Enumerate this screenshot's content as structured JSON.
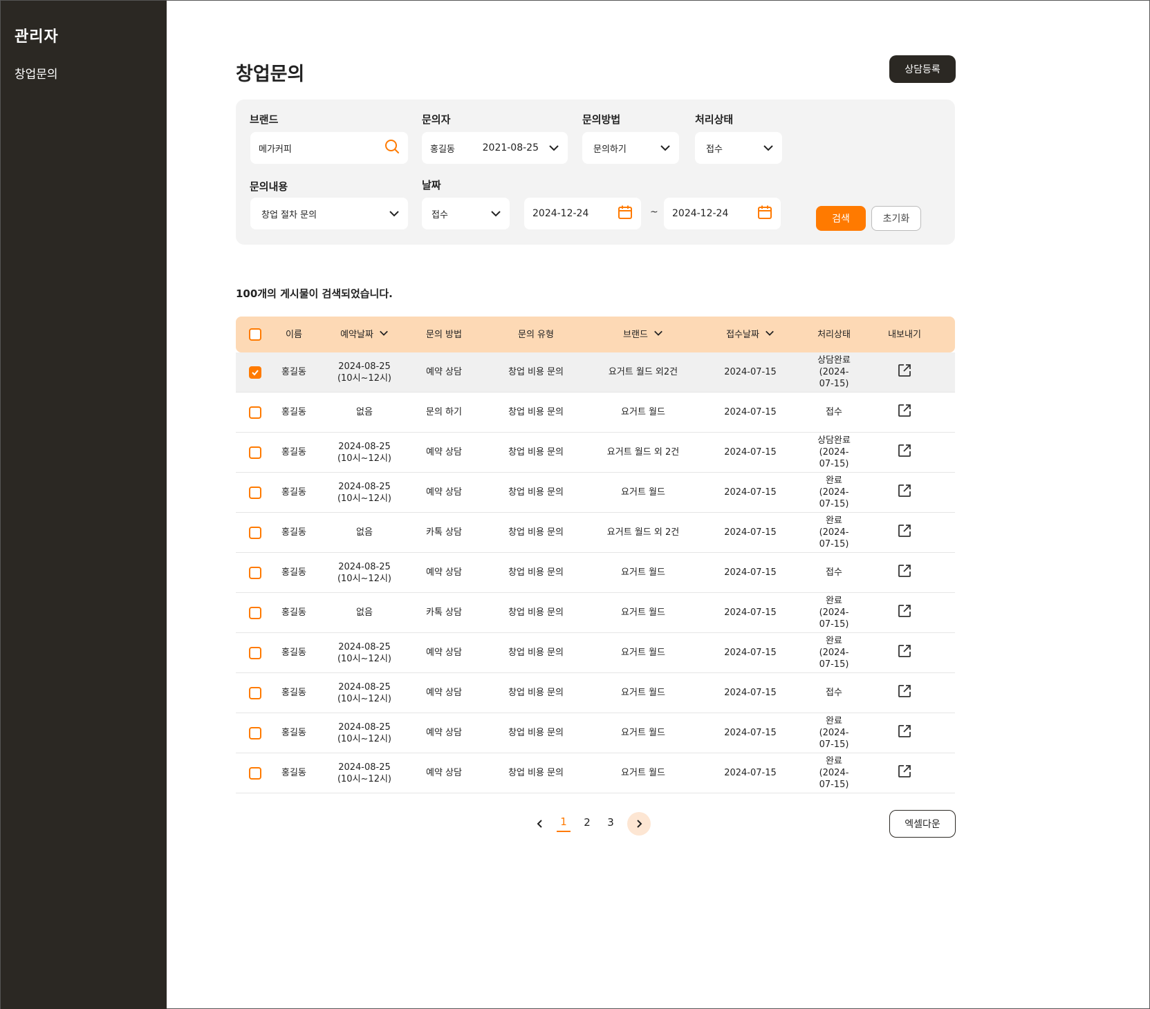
{
  "sidebar": {
    "title": "관리자",
    "items": [
      {
        "label": "창업문의"
      }
    ]
  },
  "header": {
    "title": "창업문의",
    "register_button": "상담등록"
  },
  "filters": {
    "brand_label": "브랜드",
    "brand_value": "메가커피",
    "inquirer_label": "문의자",
    "inquirer_name": "홍길동",
    "inquirer_date": "2021-08-25",
    "method_label": "문의방법",
    "method_value": "문의하기",
    "status_label": "처리상태",
    "status_value": "접수",
    "content_label": "문의내용",
    "content_value": "창업 절차 문의",
    "date_label": "날짜",
    "date_type_value": "접수",
    "date_from": "2024-12-24",
    "date_to": "2024-12-24",
    "tilde": "~",
    "search_button": "검색",
    "reset_button": "초기화"
  },
  "result_count_text": "100개의 게시물이 검색되었습니다.",
  "table": {
    "headers": {
      "name": "이름",
      "reservation_date": "예약날짜",
      "method": "문의 방법",
      "type": "문의 유형",
      "brand": "브랜드",
      "received_date": "접수날짜",
      "status": "처리상태",
      "export": "내보내기"
    },
    "rows": [
      {
        "checked": true,
        "name": "홍길동",
        "resv1": "2024-08-25",
        "resv2": "(10시~12시)",
        "method": "예약 상담",
        "type": "창업 비용 문의",
        "brand": "요거트 월드 외2건",
        "date": "2024-07-15",
        "status1": "상담완료",
        "status2": "(2024-07-15)"
      },
      {
        "checked": false,
        "name": "홍길동",
        "resv1": "없음",
        "resv2": "",
        "method": "문의 하기",
        "type": "창업 비용 문의",
        "brand": "요거트 월드",
        "date": "2024-07-15",
        "status1": "접수",
        "status2": ""
      },
      {
        "checked": false,
        "name": "홍길동",
        "resv1": "2024-08-25",
        "resv2": "(10시~12시)",
        "method": "예약 상담",
        "type": "창업 비용 문의",
        "brand": "요거트 월드 외 2건",
        "date": "2024-07-15",
        "status1": "상담완료",
        "status2": "(2024-07-15)"
      },
      {
        "checked": false,
        "name": "홍길동",
        "resv1": "2024-08-25",
        "resv2": "(10시~12시)",
        "method": "예약 상담",
        "type": "창업 비용 문의",
        "brand": "요거트 월드",
        "date": "2024-07-15",
        "status1": "완료",
        "status2": "(2024-07-15)"
      },
      {
        "checked": false,
        "name": "홍길동",
        "resv1": "없음",
        "resv2": "",
        "method": "카톡 상담",
        "type": "창업 비용 문의",
        "brand": "요거트 월드 외 2건",
        "date": "2024-07-15",
        "status1": "완료",
        "status2": "(2024-07-15)"
      },
      {
        "checked": false,
        "name": "홍길동",
        "resv1": "2024-08-25",
        "resv2": "(10시~12시)",
        "method": "예약 상담",
        "type": "창업 비용 문의",
        "brand": "요거트 월드",
        "date": "2024-07-15",
        "status1": "접수",
        "status2": ""
      },
      {
        "checked": false,
        "name": "홍길동",
        "resv1": "없음",
        "resv2": "",
        "method": "카톡 상담",
        "type": "창업 비용 문의",
        "brand": "요거트 월드",
        "date": "2024-07-15",
        "status1": "완료",
        "status2": "(2024-07-15)"
      },
      {
        "checked": false,
        "name": "홍길동",
        "resv1": "2024-08-25",
        "resv2": "(10시~12시)",
        "method": "예약 상담",
        "type": "창업 비용 문의",
        "brand": "요거트 월드",
        "date": "2024-07-15",
        "status1": "완료",
        "status2": "(2024-07-15)"
      },
      {
        "checked": false,
        "name": "홍길동",
        "resv1": "2024-08-25",
        "resv2": "(10시~12시)",
        "method": "예약 상담",
        "type": "창업 비용 문의",
        "brand": "요거트 월드",
        "date": "2024-07-15",
        "status1": "접수",
        "status2": ""
      },
      {
        "checked": false,
        "name": "홍길동",
        "resv1": "2024-08-25",
        "resv2": "(10시~12시)",
        "method": "예약 상담",
        "type": "창업 비용 문의",
        "brand": "요거트 월드",
        "date": "2024-07-15",
        "status1": "완료",
        "status2": "(2024-07-15)"
      },
      {
        "checked": false,
        "name": "홍길동",
        "resv1": "2024-08-25",
        "resv2": "(10시~12시)",
        "method": "예약 상담",
        "type": "창업 비용 문의",
        "brand": "요거트 월드",
        "date": "2024-07-15",
        "status1": "완료",
        "status2": "(2024-07-15)"
      }
    ]
  },
  "pagination": {
    "pages": [
      "1",
      "2",
      "3"
    ],
    "current": "1"
  },
  "excel_button": "엑셀다운",
  "colors": {
    "accent": "#ff7a00",
    "sidebar_bg": "#2b2823",
    "table_header_bg": "#fdd9b5"
  }
}
